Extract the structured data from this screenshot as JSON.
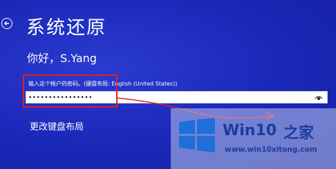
{
  "header": {
    "back_icon": "back-arrow-icon",
    "title": "系统还原"
  },
  "account": {
    "greeting": "你好，S.Yang"
  },
  "password": {
    "label": "输入这个帐户的密码。(键盘布局: English (United States))",
    "value": "••••••••••••••••",
    "reveal_icon": "eye-icon"
  },
  "links": {
    "change_keyboard_layout": "更改键盘布局"
  },
  "watermark": {
    "brand": "Win10",
    "suffix": "之家",
    "url": "www.win10xitong.com"
  },
  "colors": {
    "background": "#1a28b8",
    "highlight": "#e0201c",
    "watermark_text": "#1a3c9e"
  }
}
